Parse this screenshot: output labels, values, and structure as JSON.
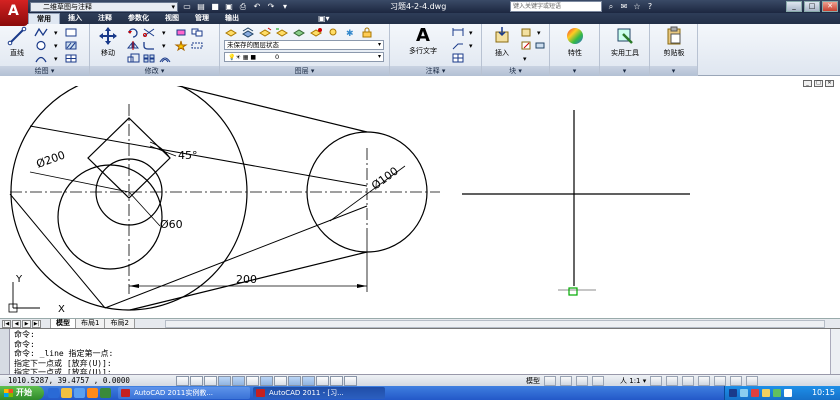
{
  "titlebar": {
    "workspace": "二维草图与注释",
    "document_title": "习题4-2-4.dwg",
    "search_placeholder": "键入关键字或短语"
  },
  "tabs": [
    "常用",
    "插入",
    "注释",
    "参数化",
    "视图",
    "管理",
    "输出"
  ],
  "ribbon": {
    "draw": {
      "title": "绘图",
      "line_label": "直线"
    },
    "modify": {
      "title": "修改",
      "move_label": "移动"
    },
    "layers": {
      "title": "图层",
      "layer_state": "未保存的图层状态",
      "current_layer": "0"
    },
    "annotation": {
      "title": "注释",
      "mtext_label": "多行文字"
    },
    "block": {
      "title": "块",
      "insert_label": "插入"
    },
    "properties": {
      "label": "特性"
    },
    "utilities": {
      "label": "实用工具"
    },
    "clipboard": {
      "label": "剪贴板"
    }
  },
  "drawing": {
    "dim_large_circle": "Ø200",
    "dim_small_circle": "Ø100",
    "dim_hole": "Ø60",
    "dim_angle": "45°",
    "dim_linear": "200",
    "ucs_x": "X",
    "ucs_y": "Y"
  },
  "layout_tabs": [
    "模型",
    "布局1",
    "布局2"
  ],
  "command_lines": [
    "命令:",
    "命令:",
    "命令: _line 指定第一点:",
    "指定下一点或 [放弃(U)]:",
    "指定下一点或 [放弃(U)]:"
  ],
  "status": {
    "coordinates": "1010.5287, 39.4757 , 0.0000",
    "model_label": "模型",
    "annotation_scale": "1:1"
  },
  "taskbar": {
    "start_label": "开始",
    "tasks": [
      "AutoCAD 2011实例教...",
      "AutoCAD 2011 - [习..."
    ],
    "clock": "10:15"
  }
}
